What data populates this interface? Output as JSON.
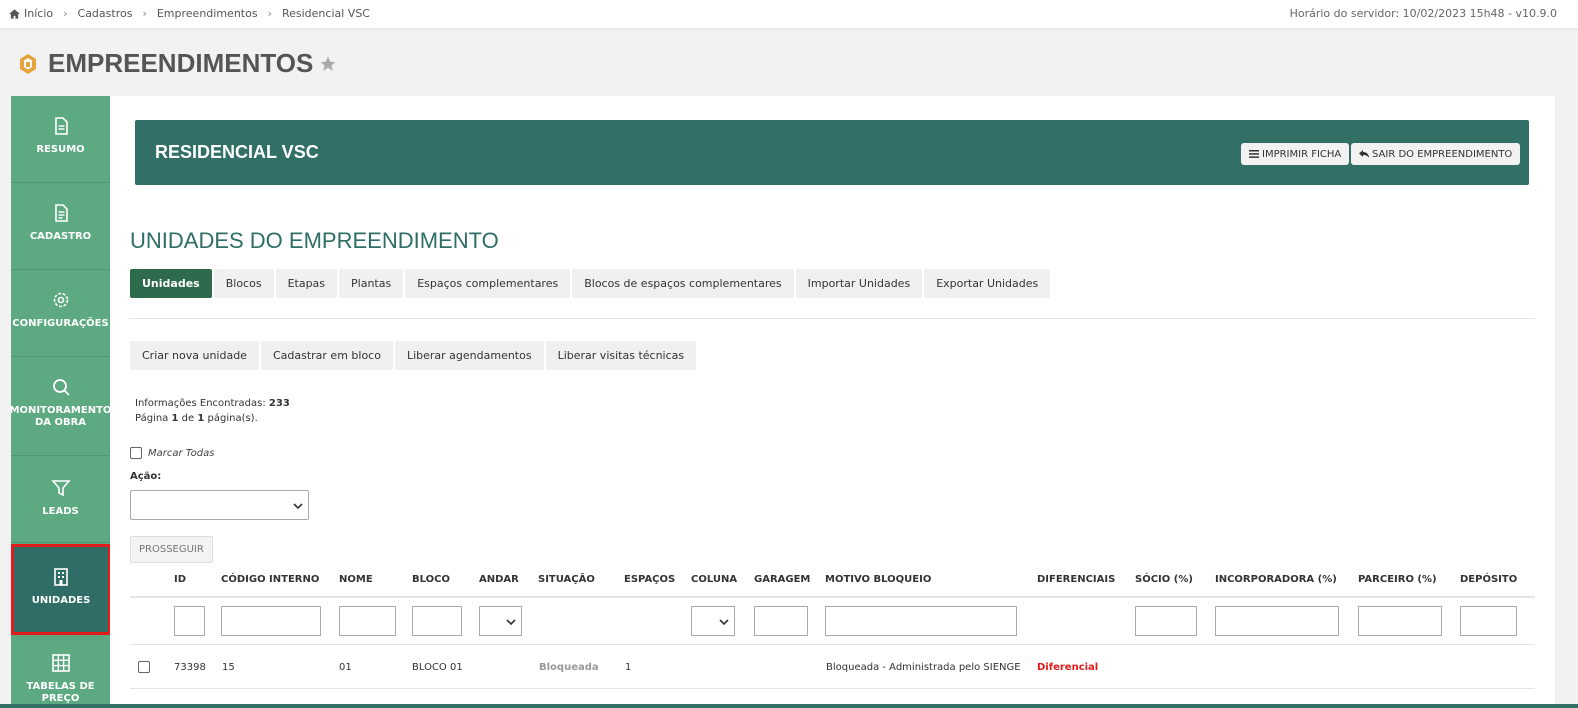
{
  "breadcrumb": [
    "Início",
    "Cadastros",
    "Empreendimentos",
    "Residencial VSC"
  ],
  "server_time": "Horário do servidor: 10/02/2023 15h48 - v10.9.0",
  "page_title": "EMPREENDIMENTOS",
  "sidebar": {
    "items": [
      {
        "label": "RESUMO",
        "icon": "document-icon"
      },
      {
        "label": "CADASTRO",
        "icon": "document-text-icon"
      },
      {
        "label": "CONFIGURAÇÕES",
        "icon": "gear-icon"
      },
      {
        "label": "MONITORAMENTO DA OBRA",
        "icon": "search-icon"
      },
      {
        "label": "LEADS",
        "icon": "funnel-icon"
      },
      {
        "label": "UNIDADES",
        "icon": "building-icon"
      },
      {
        "label": "TABELAS DE PREÇO",
        "icon": "grid-icon"
      }
    ]
  },
  "banner": {
    "title": "RESIDENCIAL VSC",
    "print_label": "IMPRIMIR FICHA",
    "exit_label": "SAIR DO EMPREENDIMENTO"
  },
  "section_title": "UNIDADES DO EMPREENDIMENTO",
  "tabs": [
    "Unidades",
    "Blocos",
    "Etapas",
    "Plantas",
    "Espaços complementares",
    "Blocos de espaços complementares",
    "Importar Unidades",
    "Exportar Unidades"
  ],
  "actions": [
    "Criar nova unidade",
    "Cadastrar em bloco",
    "Liberar agendamentos",
    "Liberar visitas técnicas"
  ],
  "info": {
    "found_label": "Informações Encontradas:",
    "found_count": "233",
    "page_prefix": "Página",
    "page_current": "1",
    "page_of": "de",
    "page_total": "1",
    "page_suffix": "página(s)."
  },
  "mark_all": "Marcar Todas",
  "acao_label": "Ação:",
  "prosseguir": "PROSSEGUIR",
  "table": {
    "headers": [
      "ID",
      "CÓDIGO INTERNO",
      "NOME",
      "BLOCO",
      "ANDAR",
      "SITUAÇÃO",
      "ESPAÇOS",
      "COLUNA",
      "GARAGEM",
      "MOTIVO BLOQUEIO",
      "DIFERENCIAIS",
      "SÓCIO (%)",
      "INCORPORADORA (%)",
      "PARCEIRO (%)",
      "DEPÓSITO"
    ],
    "rows": [
      {
        "id": "73398",
        "codigo": "15",
        "nome": "01",
        "bloco": "BLOCO 01",
        "andar": "",
        "situacao": "Bloqueada",
        "espacos": "1",
        "coluna": "",
        "garagem": "",
        "motivo": "Bloqueada - Administrada pelo SIENGE",
        "diferenciais": "Diferencial"
      }
    ]
  },
  "colors": {
    "sidebar": "#5daa82",
    "active": "#2f6d66",
    "banner": "#316f67",
    "highlight": "#e31b1b"
  }
}
